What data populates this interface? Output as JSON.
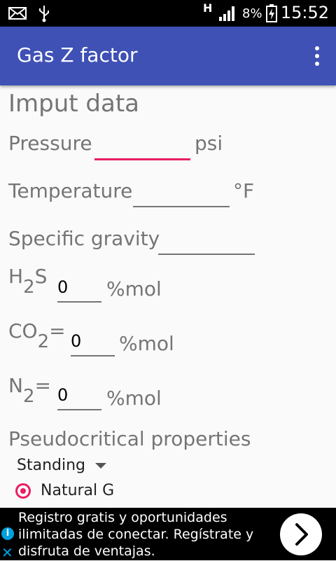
{
  "status_bar": {
    "battery": "8%",
    "time": "15:52",
    "network_label": "H"
  },
  "app_bar": {
    "title": "Gas Z factor"
  },
  "form": {
    "heading": "Imput data",
    "pressure": {
      "label": "Pressure",
      "unit": "psi",
      "value": ""
    },
    "temperature": {
      "label": "Temperature",
      "unit": "°F",
      "value": ""
    },
    "specific_gravity": {
      "label": "Specific gravity",
      "value": ""
    },
    "h2s": {
      "label_main": "H",
      "label_sub": "2",
      "label_tail": "S",
      "value": "0",
      "unit": "%mol"
    },
    "co2": {
      "label_main": "CO",
      "label_sub": "2",
      "label_tail": "=",
      "value": "0",
      "unit": "%mol"
    },
    "n2": {
      "label_main": "N",
      "label_sub": "2",
      "label_tail": "=",
      "value": "0",
      "unit": "%mol"
    },
    "pseudo_heading": "Pseudocritical properties",
    "method_selected": "Standing",
    "radio_label": "Natural G"
  },
  "ad": {
    "text": "Registro gratis y oportunidades ilimitadas de conectar. Regístrate y disfruta de ventajas."
  },
  "colors": {
    "app_bar": "#3f51b5",
    "accent": "#e91e63"
  }
}
